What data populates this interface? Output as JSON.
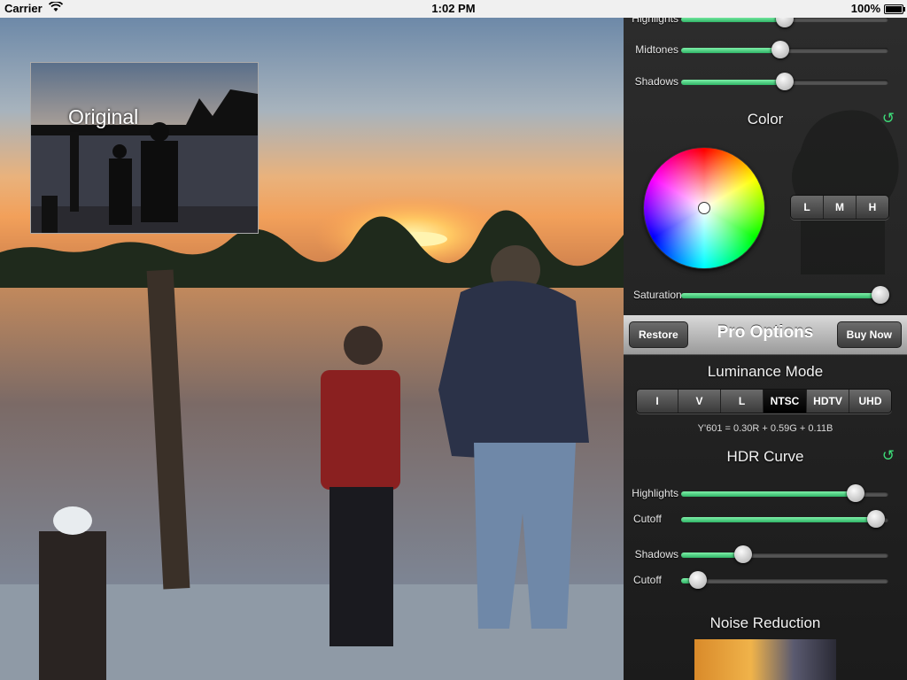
{
  "status_bar": {
    "carrier": "Carrier",
    "time": "1:02 PM",
    "battery": "100%"
  },
  "thumbnail": {
    "label": "Original"
  },
  "panel": {
    "tone_sliders": [
      {
        "label": "Highlights",
        "value": 0.5
      },
      {
        "label": "Midtones",
        "value": 0.48
      },
      {
        "label": "Shadows",
        "value": 0.5
      }
    ],
    "color": {
      "title": "Color",
      "lmh": [
        "L",
        "M",
        "H"
      ]
    },
    "saturation": {
      "label": "Saturation",
      "value": 0.96
    },
    "pro_options": {
      "title": "Pro Options",
      "restore": "Restore",
      "buy_now": "Buy Now"
    },
    "luminance_mode": {
      "title": "Luminance Mode",
      "options": [
        "I",
        "V",
        "L",
        "NTSC",
        "HDTV",
        "UHD"
      ],
      "selected": "NTSC",
      "formula": "Y'601 = 0.30R + 0.59G + 0.11B"
    },
    "hdr_curve": {
      "title": "HDR Curve",
      "sliders": [
        {
          "label": "Highlights",
          "value": 0.84
        },
        {
          "label": "Cutoff",
          "value": 0.94
        },
        {
          "label": "Shadows",
          "value": 0.3
        },
        {
          "label": "Cutoff",
          "value": 0.08
        }
      ]
    },
    "noise_reduction": {
      "title": "Noise Reduction"
    }
  },
  "colors": {
    "accent_green": "#3ddc78",
    "panel_bg": "#242424"
  }
}
